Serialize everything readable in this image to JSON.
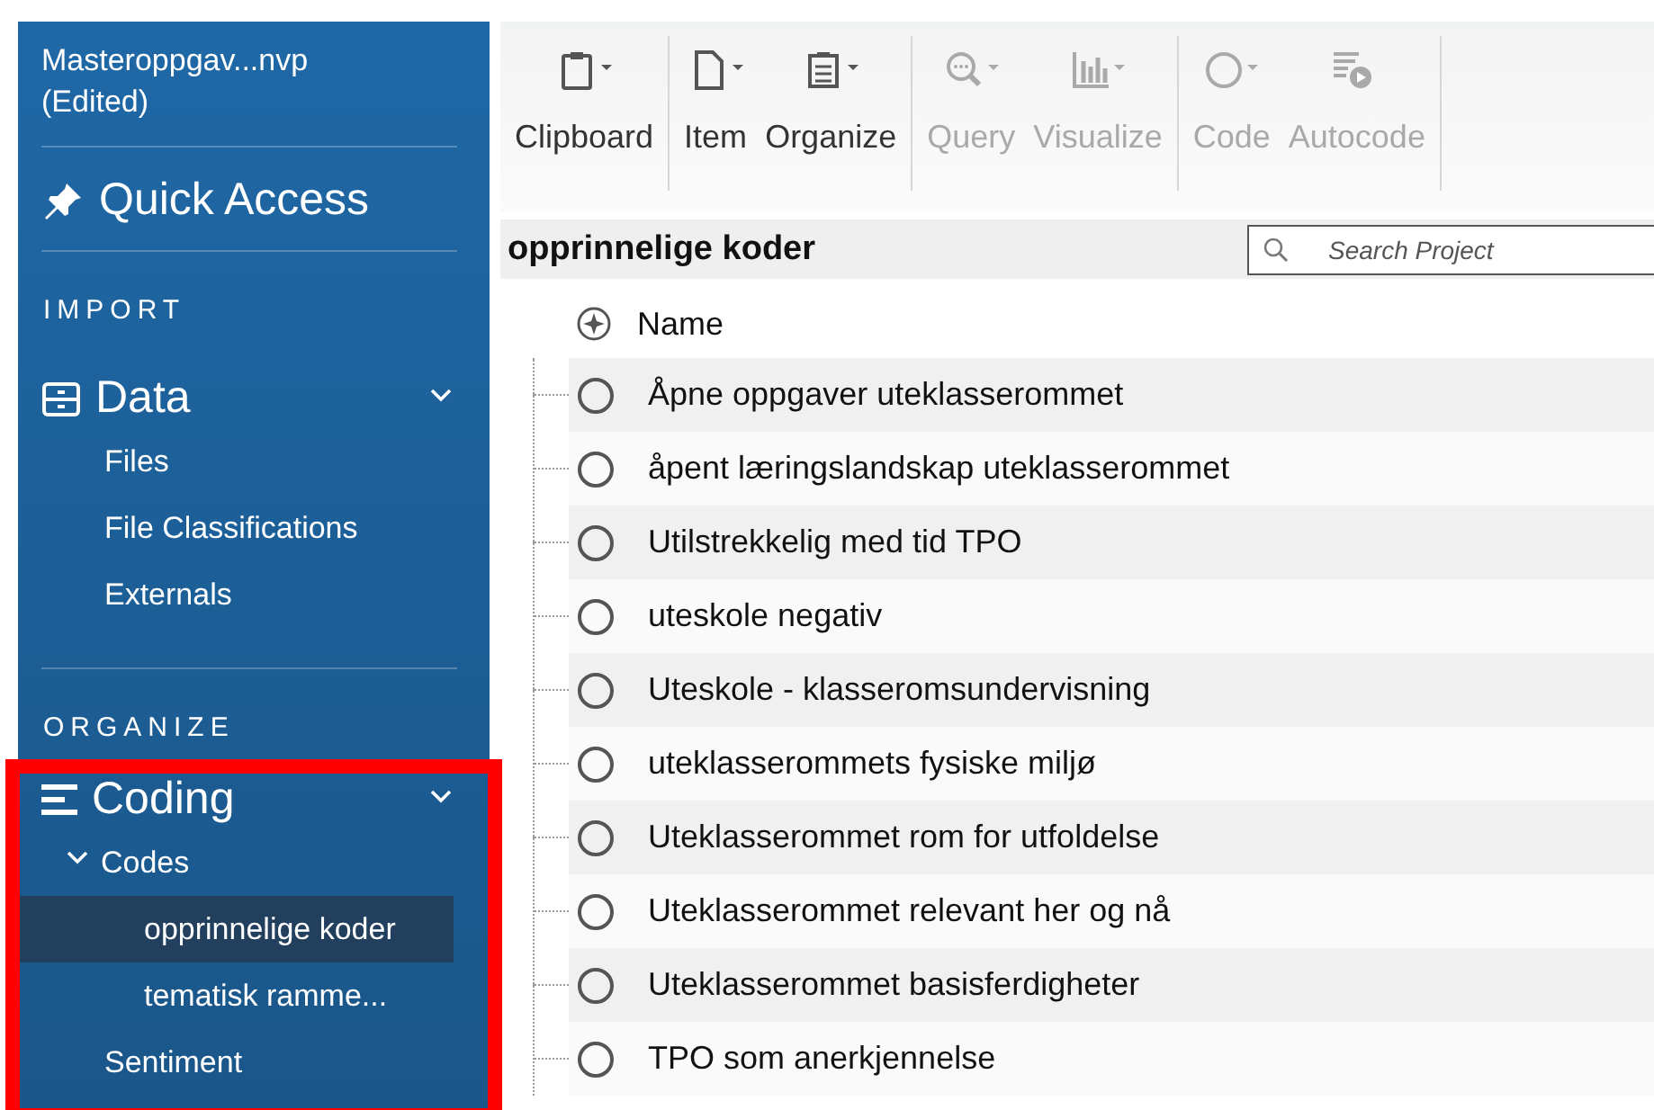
{
  "window": {
    "title": "Masteroppgav...nvp",
    "state": "(Edited)"
  },
  "sidebar": {
    "quick_access": "Quick Access",
    "sections": [
      {
        "heading": "IMPORT",
        "group": {
          "label": "Data",
          "kind": "data",
          "expanded": true,
          "highlighted": false,
          "items": [
            {
              "label": "Files",
              "selected": false
            },
            {
              "label": "File Classifications",
              "selected": false
            },
            {
              "label": "Externals",
              "selected": false
            }
          ]
        }
      },
      {
        "heading": "ORGANIZE",
        "group": {
          "label": "Coding",
          "kind": "coding",
          "expanded": true,
          "highlighted": true,
          "items": [
            {
              "label": "Codes",
              "selected": false,
              "expanded": true,
              "children": [
                {
                  "label": "opprinnelige koder",
                  "selected": true
                },
                {
                  "label": "tematisk ramme...",
                  "selected": false
                }
              ]
            },
            {
              "label": "Sentiment",
              "selected": false
            }
          ]
        }
      }
    ]
  },
  "toolbar": {
    "groups": [
      [
        {
          "label": "Clipboard",
          "kind": "clipboard",
          "disabled": false,
          "dropdown": true
        }
      ],
      [
        {
          "label": "Item",
          "kind": "item",
          "disabled": false,
          "dropdown": true
        },
        {
          "label": "Organize",
          "kind": "organize",
          "disabled": false,
          "dropdown": true
        }
      ],
      [
        {
          "label": "Query",
          "kind": "query",
          "disabled": true,
          "dropdown": true
        },
        {
          "label": "Visualize",
          "kind": "visualize",
          "disabled": true,
          "dropdown": true
        }
      ],
      [
        {
          "label": "Code",
          "kind": "code",
          "disabled": true,
          "dropdown": true
        },
        {
          "label": "Autocode",
          "kind": "autocode",
          "disabled": true,
          "dropdown": false
        }
      ]
    ]
  },
  "list": {
    "title": "opprinnelige koder",
    "search": {
      "placeholder": "Search Project"
    },
    "columns": [
      "Name"
    ],
    "rows": [
      {
        "name": "Åpne oppgaver uteklasserommet"
      },
      {
        "name": "åpent læringslandskap uteklasserommet"
      },
      {
        "name": "Utilstrekkelig med tid TPO"
      },
      {
        "name": "uteskole negativ"
      },
      {
        "name": "Uteskole - klasseromsundervisning"
      },
      {
        "name": "uteklasserommets fysiske miljø"
      },
      {
        "name": "Uteklasserommet rom for utfoldelse"
      },
      {
        "name": "Uteklasserommet relevant her og nå"
      },
      {
        "name": "Uteklasserommet basisferdigheter"
      },
      {
        "name": "TPO som anerkjennelse"
      }
    ]
  }
}
